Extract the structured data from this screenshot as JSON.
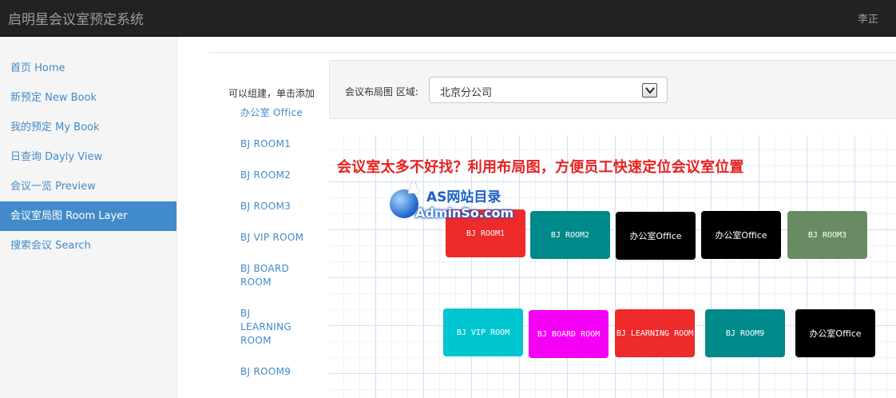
{
  "app": {
    "title": "启明星会议室预定系统",
    "user": "李正"
  },
  "sidebar": {
    "items": [
      {
        "label": "首页 Home",
        "active": false
      },
      {
        "label": "新预定 New Book",
        "active": false
      },
      {
        "label": "我的预定 My Book",
        "active": false
      },
      {
        "label": "日查询 Dayly View",
        "active": false
      },
      {
        "label": "会议一览 Preview",
        "active": false
      },
      {
        "label": "会议室局图 Room Layer",
        "active": true
      },
      {
        "label": "搜索会议 Search",
        "active": false
      }
    ]
  },
  "palette": {
    "heading": "可以组建，单击添加",
    "items": [
      "办公室 Office",
      "BJ ROOM1",
      "BJ ROOM2",
      "BJ ROOM3",
      "BJ VIP ROOM",
      "BJ BOARD ROOM",
      "BJ LEARNING ROOM",
      "BJ ROOM9"
    ]
  },
  "filter": {
    "label": "会议布局图 区域:",
    "selected": "北京分公司"
  },
  "layout": {
    "banner": "会议室太多不好找？利用布局图，方便员工快速定位会议室位置",
    "rooms": [
      {
        "label": "BJ ROOM1",
        "color": "#ee2a2a"
      },
      {
        "label": "BJ ROOM2",
        "color": "#00898a"
      },
      {
        "label": "办公室Office",
        "color": "#000000"
      },
      {
        "label": "办公室Office",
        "color": "#000000"
      },
      {
        "label": "BJ ROOM3",
        "color": "#688c62"
      },
      {
        "label": "BJ VIP ROOM",
        "color": "#00c6d2"
      },
      {
        "label": "BJ BOARD ROOM",
        "color": "#f400f4"
      },
      {
        "label": "BJ LEARNING ROOM",
        "color": "#ee2a2a"
      },
      {
        "label": "BJ ROOM9",
        "color": "#00898a"
      },
      {
        "label": "办公室Office",
        "color": "#000000"
      }
    ]
  },
  "watermark": {
    "title": "AS网站目录",
    "domain": "AdminSo.com"
  },
  "colors": {
    "accent": "#428bca",
    "topbar": "#222222",
    "banner": "#e82020"
  }
}
